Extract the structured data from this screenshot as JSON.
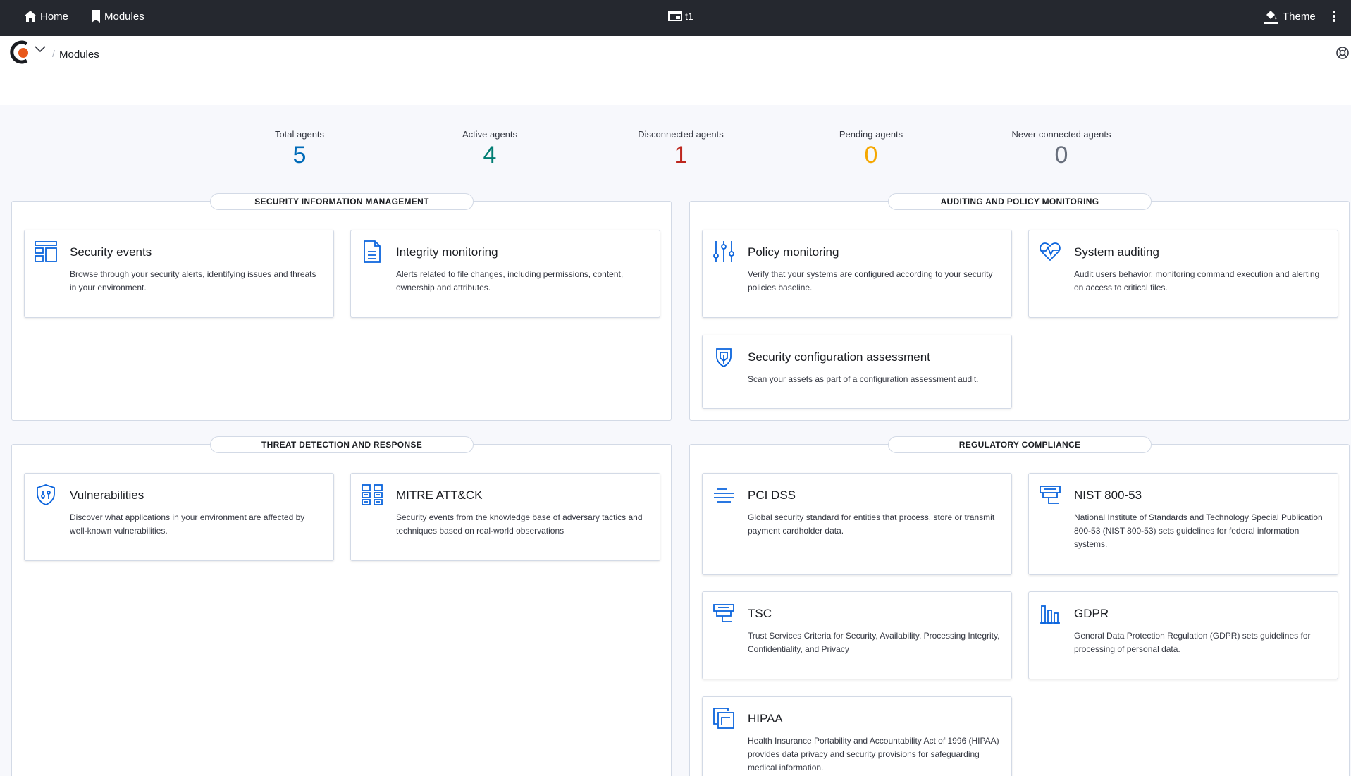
{
  "topbar": {
    "home_label": "Home",
    "modules_label": "Modules",
    "tenant_label": "t1",
    "theme_label": "Theme"
  },
  "breadcrumb": {
    "current": "Modules"
  },
  "stats": [
    {
      "label": "Total agents",
      "value": "5",
      "color": "#006bb8"
    },
    {
      "label": "Active agents",
      "value": "4",
      "color": "#017d73"
    },
    {
      "label": "Disconnected agents",
      "value": "1",
      "color": "#bd271e"
    },
    {
      "label": "Pending agents",
      "value": "0",
      "color": "#f5a700"
    },
    {
      "label": "Never connected agents",
      "value": "0",
      "color": "#69707d"
    }
  ],
  "sections": {
    "sim": {
      "title": "SECURITY INFORMATION MANAGEMENT",
      "cards": [
        {
          "icon": "security-events-icon",
          "title": "Security events",
          "desc": "Browse through your security alerts, identifying issues and threats in your environment."
        },
        {
          "icon": "document-icon",
          "title": "Integrity monitoring",
          "desc": "Alerts related to file changes, including permissions, content, ownership and attributes."
        }
      ]
    },
    "apm": {
      "title": "AUDITING AND POLICY MONITORING",
      "cards": [
        {
          "icon": "sliders-icon",
          "title": "Policy monitoring",
          "desc": "Verify that your systems are configured according to your security policies baseline."
        },
        {
          "icon": "heartbeat-icon",
          "title": "System auditing",
          "desc": "Audit users behavior, monitoring command execution and alerting on access to critical files."
        },
        {
          "icon": "shield-check-icon",
          "title": "Security configuration assessment",
          "desc": "Scan your assets as part of a configuration assessment audit."
        }
      ]
    },
    "tdr": {
      "title": "THREAT DETECTION AND RESPONSE",
      "cards": [
        {
          "icon": "shield-gear-icon",
          "title": "Vulnerabilities",
          "desc": "Discover what applications in your environment are affected by well-known vulnerabilities."
        },
        {
          "icon": "grid-icon",
          "title": "MITRE ATT&CK",
          "desc": "Security events from the knowledge base of adversary tactics and techniques based on real-world observations"
        }
      ]
    },
    "rc": {
      "title": "REGULATORY COMPLIANCE",
      "cards": [
        {
          "icon": "lines-icon",
          "title": "PCI DSS",
          "desc": "Global security standard for entities that process, store or transmit payment cardholder data."
        },
        {
          "icon": "monitor-icon",
          "title": "NIST 800-53",
          "desc": "National Institute of Standards and Technology Special Publication 800-53 (NIST 800-53) sets guidelines for federal information systems."
        },
        {
          "icon": "monitor-icon",
          "title": "TSC",
          "desc": "Trust Services Criteria for Security, Availability, Processing Integrity, Confidentiality, and Privacy"
        },
        {
          "icon": "bar-chart-icon",
          "title": "GDPR",
          "desc": "General Data Protection Regulation (GDPR) sets guidelines for processing of personal data."
        },
        {
          "icon": "copy-icon",
          "title": "HIPAA",
          "desc": "Health Insurance Portability and Accountability Act of 1996 (HIPAA) provides data privacy and security provisions for safeguarding medical information."
        }
      ]
    }
  },
  "colors": {
    "topbar_bg": "#25282f",
    "icon_accent": "#0b64dd",
    "content_bg": "#f7f8fc"
  }
}
